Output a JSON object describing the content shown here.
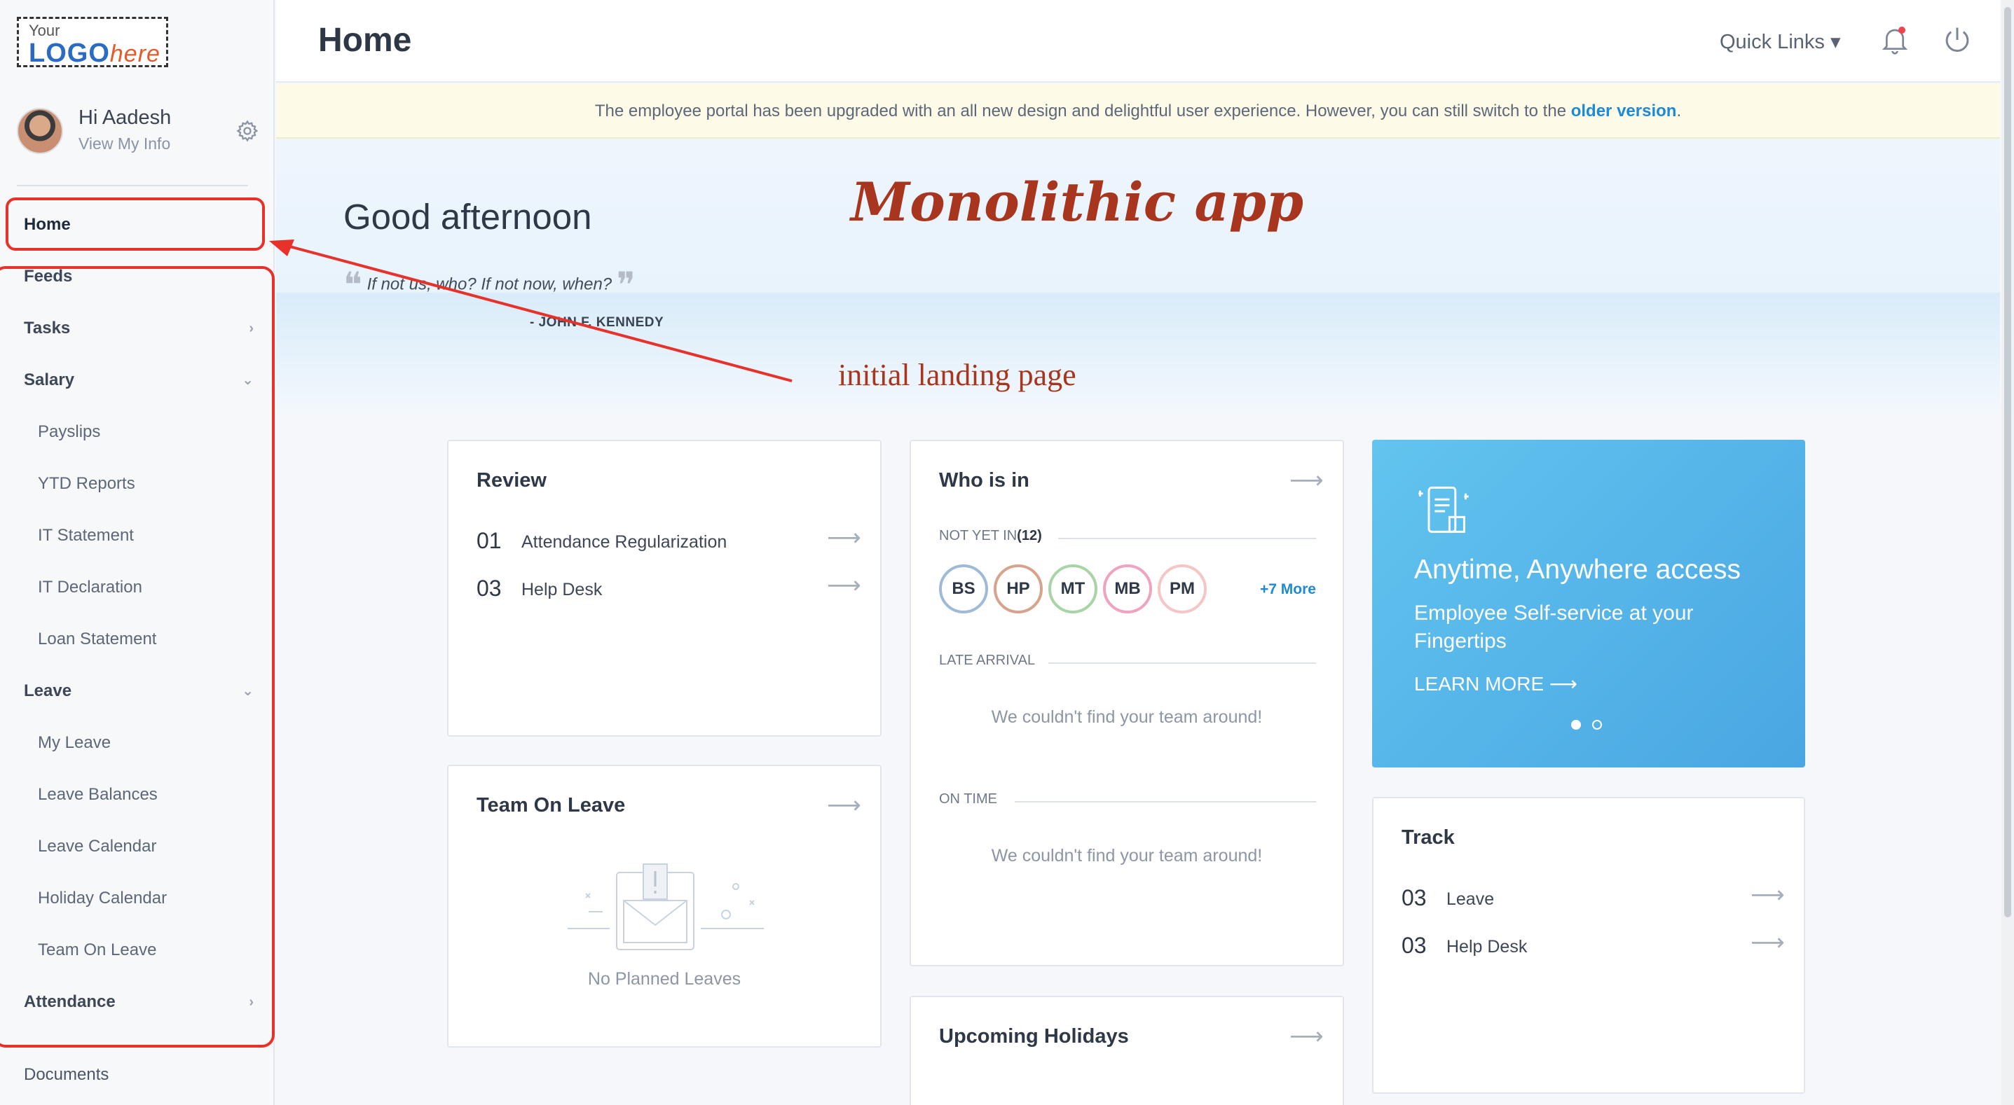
{
  "logo": {
    "line1": "Your",
    "line2": "LOGO",
    "line2b": "here"
  },
  "user": {
    "greeting": "Hi Aadesh",
    "sub": "View My Info"
  },
  "sidebar": {
    "items": [
      {
        "label": "Home",
        "kind": "top"
      },
      {
        "label": "Feeds",
        "kind": "top"
      },
      {
        "label": "Tasks",
        "kind": "top",
        "chevron": "›"
      },
      {
        "label": "Salary",
        "kind": "top",
        "chevron": "⌄"
      },
      {
        "label": "Payslips",
        "kind": "sub"
      },
      {
        "label": "YTD Reports",
        "kind": "sub"
      },
      {
        "label": "IT Statement",
        "kind": "sub"
      },
      {
        "label": "IT Declaration",
        "kind": "sub"
      },
      {
        "label": "Loan Statement",
        "kind": "sub"
      },
      {
        "label": "Leave",
        "kind": "top",
        "chevron": "⌄"
      },
      {
        "label": "My Leave",
        "kind": "sub"
      },
      {
        "label": "Leave Balances",
        "kind": "sub"
      },
      {
        "label": "Leave Calendar",
        "kind": "sub"
      },
      {
        "label": "Holiday Calendar",
        "kind": "sub"
      },
      {
        "label": "Team On Leave",
        "kind": "sub"
      },
      {
        "label": "Attendance",
        "kind": "top",
        "chevron": "›"
      },
      {
        "label": "",
        "kind": "spacer"
      },
      {
        "label": "Documents",
        "kind": "plain"
      }
    ]
  },
  "header": {
    "title": "Home",
    "quick_links": "Quick Links ▾"
  },
  "banner": {
    "text": "The employee portal has been upgraded with an all new design and delightful user experience. However, you can still switch to the ",
    "link": "older version",
    "end": "."
  },
  "hero": {
    "greeting": "Good afternoon",
    "quote": "If not us, who? If not now, when?",
    "author": "- JOHN F. KENNEDY",
    "open_mark": "❝",
    "close_mark": "❞"
  },
  "annotations": {
    "title": "Monolithic app",
    "subtitle": "initial landing page"
  },
  "review": {
    "title": "Review",
    "rows": [
      {
        "num": "01",
        "label": "Attendance Regularization"
      },
      {
        "num": "03",
        "label": "Help Desk"
      }
    ]
  },
  "team_on_leave": {
    "title": "Team On Leave",
    "empty": "No Planned Leaves"
  },
  "who_is_in": {
    "title": "Who is in",
    "not_yet_in_label": "NOT YET IN",
    "not_yet_in_count": "(12)",
    "chips": [
      {
        "initials": "BS",
        "color": "#9fbad6"
      },
      {
        "initials": "HP",
        "color": "#d7a38c"
      },
      {
        "initials": "MT",
        "color": "#a9d4a6"
      },
      {
        "initials": "MB",
        "color": "#f0a3c1"
      },
      {
        "initials": "PM",
        "color": "#f6c6c6"
      }
    ],
    "more": "+7 More",
    "late_label": "LATE ARRIVAL",
    "late_empty": "We couldn't find your team around!",
    "on_time_label": "ON TIME",
    "on_time_empty": "We couldn't find your team around!"
  },
  "promo": {
    "title": "Anytime, Anywhere access",
    "subtitle": "Employee Self-service at your Fingertips",
    "link": "LEARN MORE ⟶"
  },
  "track": {
    "title": "Track",
    "rows": [
      {
        "num": "03",
        "label": "Leave"
      },
      {
        "num": "03",
        "label": "Help Desk"
      }
    ]
  },
  "holidays": {
    "title": "Upcoming Holidays"
  },
  "icons": {
    "arrow": "⟶"
  },
  "colors": {
    "accent": "#1d8ad6",
    "annotation": "#e8312a",
    "annotation_text": "#a8351d"
  }
}
